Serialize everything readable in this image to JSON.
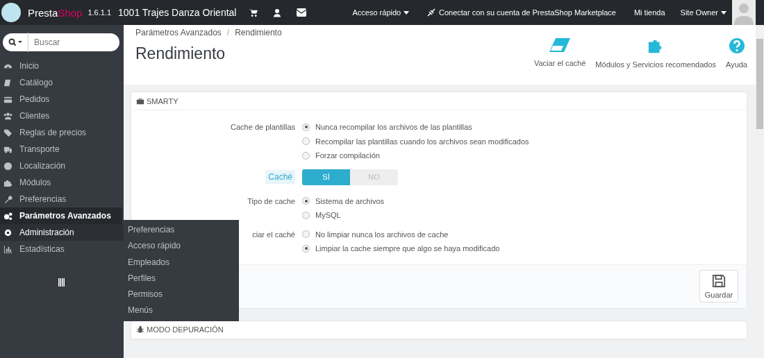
{
  "topbar": {
    "brand_prefix": "Presta",
    "brand_suffix": "Shop",
    "version": "1.6.1.1",
    "shop_name": "1001 Trajes Danza Oriental",
    "quick_access": "Acceso rápido",
    "marketplace": "Conectar con su cuenta de PrestaShop Marketplace",
    "my_shop": "Mi tienda",
    "user": "Site Owner"
  },
  "search": {
    "placeholder": "Buscar"
  },
  "sidebar": {
    "items": [
      {
        "label": "Inicio",
        "selected": false,
        "expanded": false
      },
      {
        "label": "Catálogo",
        "selected": false,
        "expanded": false
      },
      {
        "label": "Pedidos",
        "selected": false,
        "expanded": false
      },
      {
        "label": "Clientes",
        "selected": false,
        "expanded": false
      },
      {
        "label": "Reglas de precios",
        "selected": false,
        "expanded": false
      },
      {
        "label": "Transporte",
        "selected": false,
        "expanded": false
      },
      {
        "label": "Localización",
        "selected": false,
        "expanded": false
      },
      {
        "label": "Módulos",
        "selected": false,
        "expanded": false
      },
      {
        "label": "Preferencias",
        "selected": false,
        "expanded": false
      },
      {
        "label": "Parámetros Avanzados",
        "selected": true,
        "expanded": false
      },
      {
        "label": "Administración",
        "selected": false,
        "expanded": true,
        "children": [
          {
            "label": "Preferencias"
          },
          {
            "label": "Acceso rápido"
          },
          {
            "label": "Empleados"
          },
          {
            "label": "Perfiles"
          },
          {
            "label": "Permisos"
          },
          {
            "label": "Menús"
          }
        ]
      },
      {
        "label": "Estadísticas",
        "selected": false,
        "expanded": false
      }
    ]
  },
  "breadcrumb": [
    "Parámetros Avanzados",
    "Rendimiento"
  ],
  "breadcrumb_separator": "/",
  "page_title": "Rendimiento",
  "toolbar": [
    {
      "label": "Vaciar el caché"
    },
    {
      "label": "Módulos y Servicios recomendados"
    },
    {
      "label": "Ayuda"
    }
  ],
  "panels": [
    {
      "title": "SMARTY",
      "fields": [
        {
          "kind": "radio",
          "label": "Cache de plantillas",
          "options": [
            {
              "label": "Nunca recompilar los archivos de las plantillas",
              "selected": true
            },
            {
              "label": "Recompilar las plantillas cuando los archivos sean modificados",
              "selected": false
            },
            {
              "label": "Forzar compilación",
              "selected": false
            }
          ]
        },
        {
          "kind": "switch",
          "label": "Caché",
          "highlighted": true,
          "options": [
            {
              "label": "SÍ",
              "selected": true
            },
            {
              "label": "NO",
              "selected": false
            }
          ]
        },
        {
          "kind": "radio",
          "label": "Tipo de cache",
          "options": [
            {
              "label": "Sistema de archivos",
              "selected": true
            },
            {
              "label": "MySQL",
              "selected": false
            }
          ]
        },
        {
          "kind": "radio",
          "label": "ciar el caché",
          "options": [
            {
              "label": "No limpiar nunca los archivos de cache",
              "selected": false
            },
            {
              "label": "Limpiar la cache siempre que algo se haya modificado",
              "selected": true
            }
          ]
        }
      ],
      "save_button": "Guardar"
    },
    {
      "title": "MODO DEPURACIÓN"
    }
  ]
}
